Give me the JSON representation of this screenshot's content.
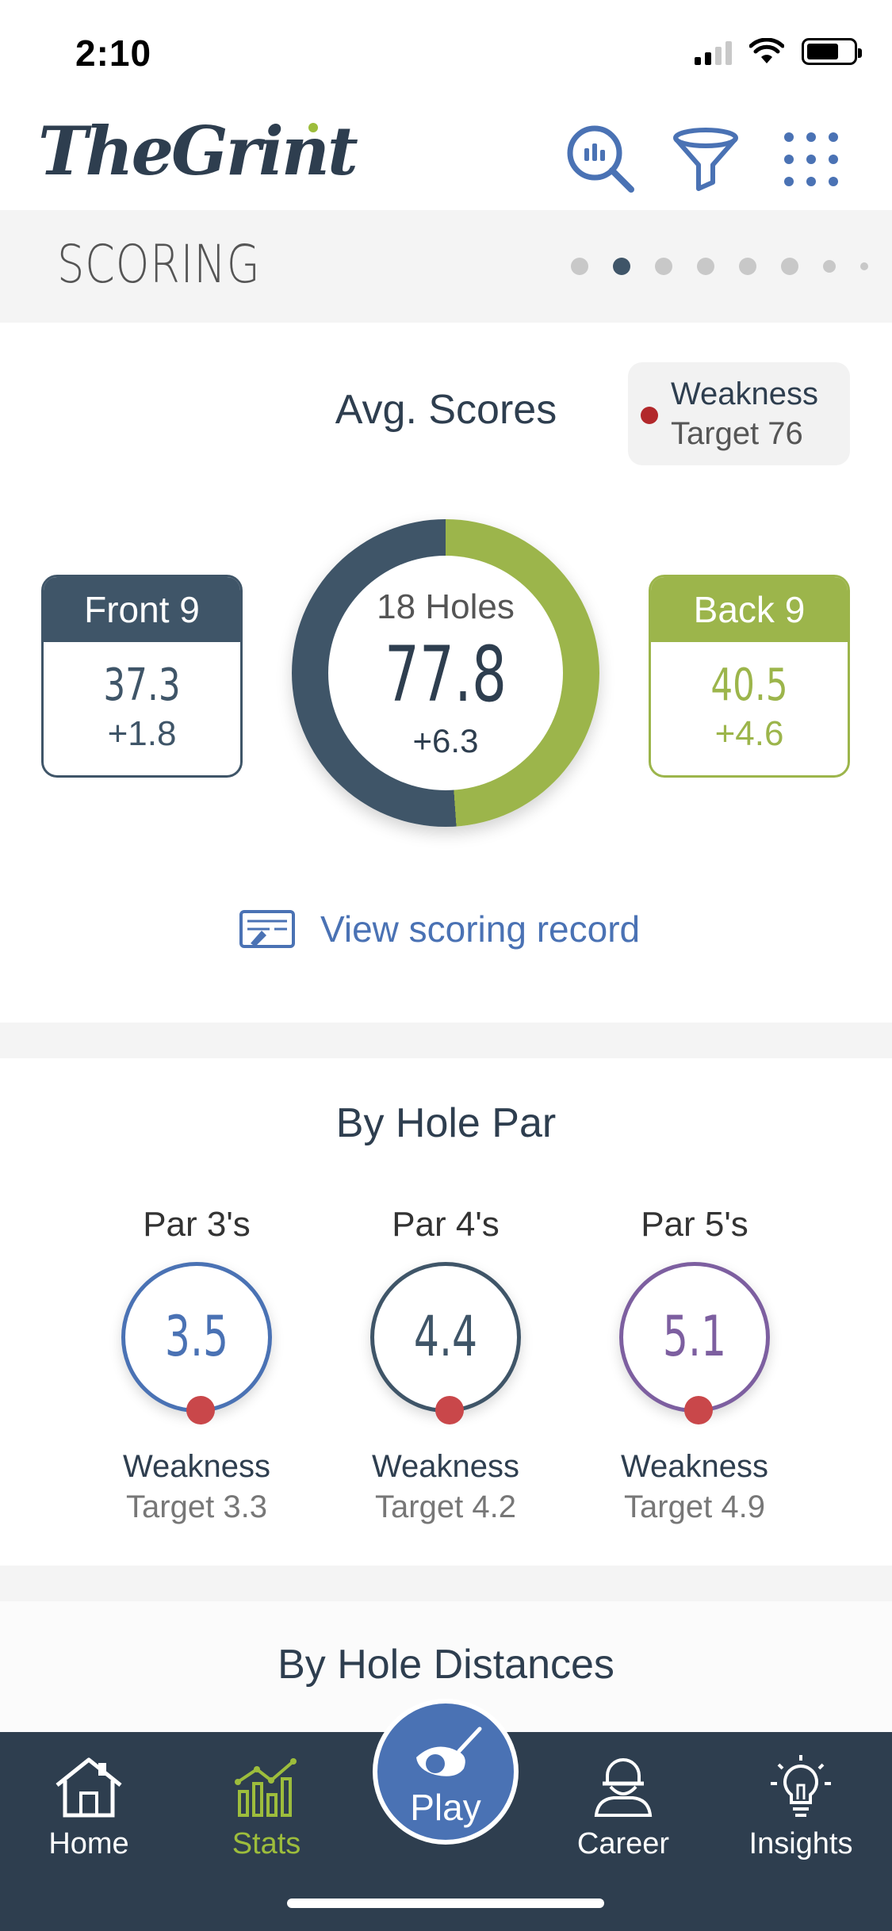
{
  "status": {
    "time": "2:10"
  },
  "header": {
    "logo": "TheGrint"
  },
  "section": {
    "title": "SCORING"
  },
  "avg_scores": {
    "title": "Avg. Scores",
    "legend": {
      "label": "Weakness",
      "target": "Target 76",
      "color": "#b2282b"
    },
    "front9": {
      "label": "Front 9",
      "score": "37.3",
      "delta": "+1.8"
    },
    "eighteen": {
      "label": "18 Holes",
      "score": "77.8",
      "delta": "+6.3",
      "front_share": 37.3,
      "back_share": 40.5
    },
    "back9": {
      "label": "Back 9",
      "score": "40.5",
      "delta": "+4.6"
    },
    "record_link": "View scoring record"
  },
  "by_hole_par": {
    "title": "By Hole Par",
    "items": [
      {
        "name": "Par 3's",
        "value": "3.5",
        "status": "Weakness",
        "target": "Target 3.3",
        "color": "#4a72b4"
      },
      {
        "name": "Par 4's",
        "value": "4.4",
        "status": "Weakness",
        "target": "Target 4.2",
        "color": "#3f5568"
      },
      {
        "name": "Par 5's",
        "value": "5.1",
        "status": "Weakness",
        "target": "Target 4.9",
        "color": "#7d5fa0"
      }
    ]
  },
  "by_hole_distances": {
    "title": "By Hole Distances"
  },
  "tabs": [
    {
      "label": "Home",
      "icon": "home-icon"
    },
    {
      "label": "Stats",
      "icon": "stats-icon",
      "active": true
    },
    {
      "label": "Play",
      "icon": "golf-club-icon"
    },
    {
      "label": "Career",
      "icon": "career-icon"
    },
    {
      "label": "Insights",
      "icon": "lightbulb-icon"
    }
  ],
  "colors": {
    "front": "#3f5568",
    "back": "#9cb54b",
    "accent": "#4a72b4",
    "tab_bar": "#2e3e4f",
    "active_tab": "#9dbd3c"
  }
}
